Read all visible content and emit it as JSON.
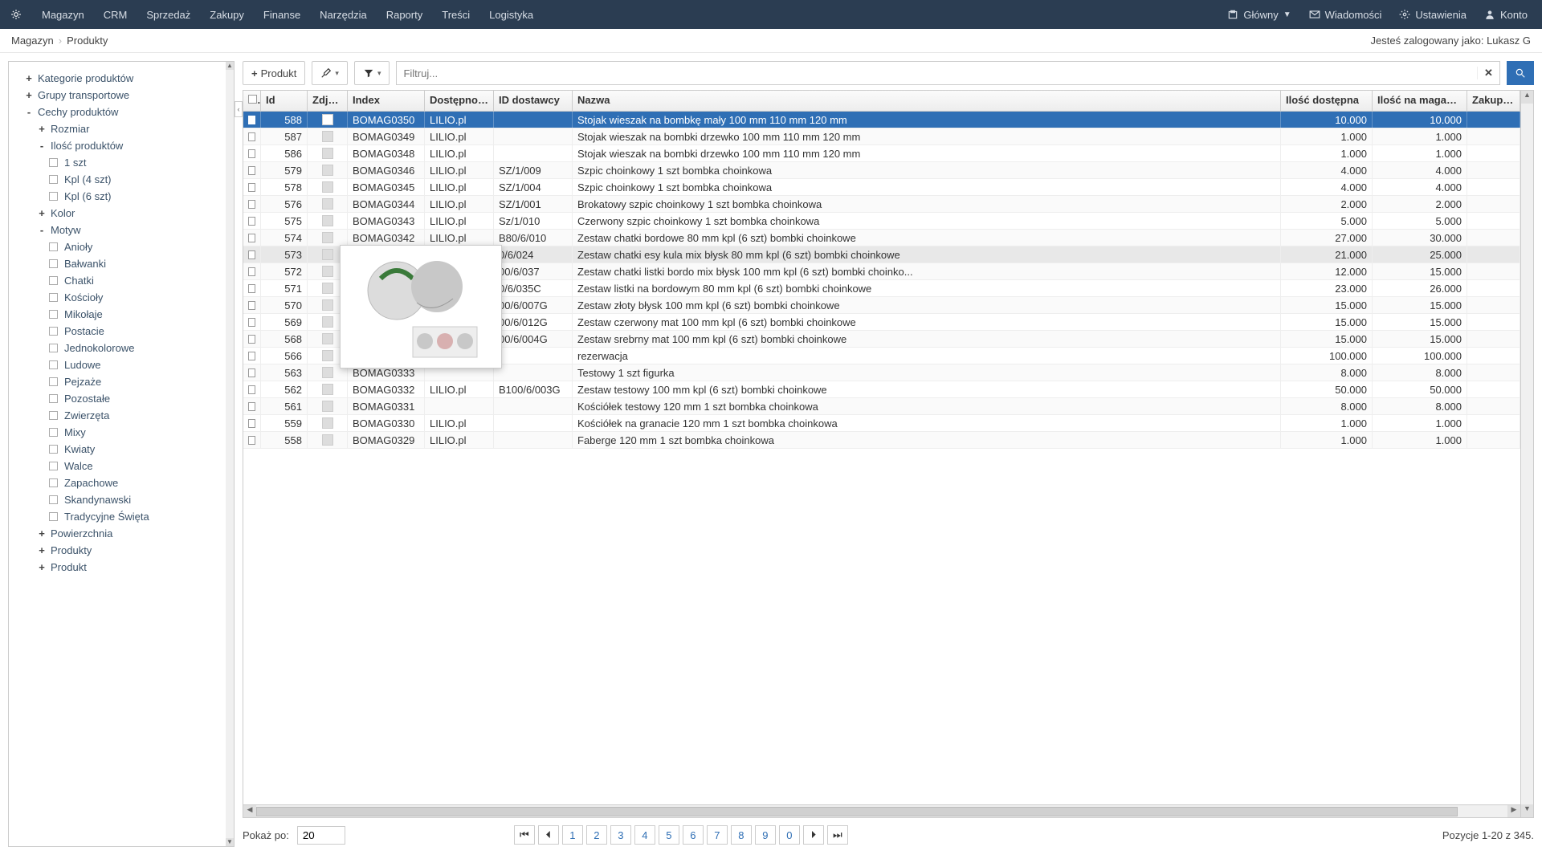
{
  "top_menu": [
    "Magazyn",
    "CRM",
    "Sprzedaż",
    "Zakupy",
    "Finanse",
    "Narzędzia",
    "Raporty",
    "Treści",
    "Logistyka"
  ],
  "top_right": {
    "main": "Główny",
    "messages": "Wiadomości",
    "settings": "Ustawienia",
    "account": "Konto"
  },
  "breadcrumb": {
    "root": "Magazyn",
    "leaf": "Produkty"
  },
  "logged_in_prefix": "Jesteś zalogowany jako: ",
  "logged_in_user": "Lukasz G",
  "toolbar": {
    "add_product": "Produkt",
    "filter_placeholder": "Filtruj..."
  },
  "sidebar": {
    "nodes": [
      {
        "exp": "+",
        "label": "Kategorie produktów"
      },
      {
        "exp": "+",
        "label": "Grupy transportowe"
      },
      {
        "exp": "-",
        "label": "Cechy produktów",
        "children": [
          {
            "exp": "+",
            "label": "Rozmiar"
          },
          {
            "exp": "-",
            "label": "Ilość produktów",
            "children": [
              {
                "chk": true,
                "label": "1 szt"
              },
              {
                "chk": true,
                "label": "Kpl (4 szt)"
              },
              {
                "chk": true,
                "label": "Kpl (6 szt)"
              }
            ]
          },
          {
            "exp": "+",
            "label": "Kolor"
          },
          {
            "exp": "-",
            "label": "Motyw",
            "children": [
              {
                "chk": true,
                "label": "Anioły"
              },
              {
                "chk": true,
                "label": "Bałwanki"
              },
              {
                "chk": true,
                "label": "Chatki"
              },
              {
                "chk": true,
                "label": "Kościoły"
              },
              {
                "chk": true,
                "label": "Mikołaje"
              },
              {
                "chk": true,
                "label": "Postacie"
              },
              {
                "chk": true,
                "label": "Jednokolorowe"
              },
              {
                "chk": true,
                "label": "Ludowe"
              },
              {
                "chk": true,
                "label": "Pejzaże"
              },
              {
                "chk": true,
                "label": "Pozostałe"
              },
              {
                "chk": true,
                "label": "Zwierzęta"
              },
              {
                "chk": true,
                "label": "Mixy"
              },
              {
                "chk": true,
                "label": "Kwiaty"
              },
              {
                "chk": true,
                "label": "Walce"
              },
              {
                "chk": true,
                "label": "Zapachowe"
              },
              {
                "chk": true,
                "label": "Skandynawski"
              },
              {
                "chk": true,
                "label": "Tradycyjne Święta"
              }
            ]
          },
          {
            "exp": "+",
            "label": "Powierzchnia"
          },
          {
            "exp": "+",
            "label": "Produkty"
          },
          {
            "exp": "+",
            "label": "Produkt"
          }
        ]
      }
    ]
  },
  "columns": [
    "",
    "Id",
    "Zdjęcie",
    "Index",
    "Dostępność",
    "ID dostawcy",
    "Nazwa",
    "Ilość dostępna",
    "Ilość na magazyn...",
    "Zakup bru"
  ],
  "rows": [
    {
      "sel": true,
      "id": 588,
      "idx": "BOMAG0350",
      "av": "LILIO.pl",
      "sup": "",
      "name": "Stojak wieszak na bombkę mały 100 mm 110 mm 120 mm",
      "q1": "10.000",
      "q2": "10.000"
    },
    {
      "id": 587,
      "idx": "BOMAG0349",
      "av": "LILIO.pl",
      "sup": "",
      "name": "Stojak wieszak na bombki drzewko 100 mm 110 mm 120 mm",
      "q1": "1.000",
      "q2": "1.000"
    },
    {
      "id": 586,
      "idx": "BOMAG0348",
      "av": "LILIO.pl",
      "sup": "",
      "name": "Stojak wieszak na bombki drzewko 100 mm 110 mm 120 mm",
      "q1": "1.000",
      "q2": "1.000"
    },
    {
      "id": 579,
      "idx": "BOMAG0346",
      "av": "LILIO.pl",
      "sup": "SZ/1/009",
      "name": "Szpic choinkowy 1 szt bombka choinkowa",
      "q1": "4.000",
      "q2": "4.000"
    },
    {
      "id": 578,
      "idx": "BOMAG0345",
      "av": "LILIO.pl",
      "sup": "SZ/1/004",
      "name": "Szpic choinkowy 1 szt bombka choinkowa",
      "q1": "4.000",
      "q2": "4.000"
    },
    {
      "id": 576,
      "idx": "BOMAG0344",
      "av": "LILIO.pl",
      "sup": "SZ/1/001",
      "name": "Brokatowy szpic choinkowy 1 szt bombka choinkowa",
      "q1": "2.000",
      "q2": "2.000"
    },
    {
      "id": 575,
      "idx": "BOMAG0343",
      "av": "LILIO.pl",
      "sup": "Sz/1/010",
      "name": "Czerwony szpic choinkowy 1 szt bombka choinkowa",
      "q1": "5.000",
      "q2": "5.000"
    },
    {
      "id": 574,
      "idx": "BOMAG0342",
      "av": "LILIO.pl",
      "sup": "B80/6/010",
      "name": "Zestaw chatki bordowe 80 mm kpl (6 szt) bombki choinkowe",
      "q1": "27.000",
      "q2": "30.000"
    },
    {
      "hov": true,
      "id": 573,
      "idx": "",
      "av": "",
      "sup": "0/6/024",
      "name": "Zestaw chatki esy kula mix błysk 80 mm kpl (6 szt) bombki choinkowe",
      "q1": "21.000",
      "q2": "25.000"
    },
    {
      "id": 572,
      "idx": "",
      "av": "",
      "sup": "00/6/037",
      "name": "Zestaw chatki listki bordo mix błysk 100 mm kpl (6 szt) bombki choinko...",
      "q1": "12.000",
      "q2": "15.000"
    },
    {
      "id": 571,
      "idx": "",
      "av": "",
      "sup": "0/6/035C",
      "name": "Zestaw listki na bordowym 80 mm kpl (6 szt) bombki choinkowe",
      "q1": "23.000",
      "q2": "26.000"
    },
    {
      "id": 570,
      "idx": "",
      "av": "",
      "sup": "00/6/007G",
      "name": "Zestaw złoty błysk 100 mm kpl (6 szt) bombki choinkowe",
      "q1": "15.000",
      "q2": "15.000"
    },
    {
      "id": 569,
      "idx": "",
      "av": "",
      "sup": "00/6/012G",
      "name": "Zestaw czerwony mat 100 mm kpl (6 szt) bombki choinkowe",
      "q1": "15.000",
      "q2": "15.000"
    },
    {
      "id": 568,
      "idx": "",
      "av": "",
      "sup": "00/6/004G",
      "name": "Zestaw srebrny mat 100 mm kpl (6 szt) bombki choinkowe",
      "q1": "15.000",
      "q2": "15.000"
    },
    {
      "id": 566,
      "idx": "",
      "av": "",
      "sup": "",
      "name": "rezerwacja",
      "q1": "100.000",
      "q2": "100.000"
    },
    {
      "id": 563,
      "idx": "BOMAG0333",
      "av": "",
      "sup": "",
      "name": "Testowy 1 szt figurka",
      "q1": "8.000",
      "q2": "8.000"
    },
    {
      "id": 562,
      "idx": "BOMAG0332",
      "av": "LILIO.pl",
      "sup": "B100/6/003G",
      "name": "Zestaw testowy 100 mm kpl (6 szt) bombki choinkowe",
      "q1": "50.000",
      "q2": "50.000"
    },
    {
      "id": 561,
      "idx": "BOMAG0331",
      "av": "",
      "sup": "",
      "name": "Kościółek testowy 120 mm 1 szt bombka choinkowa",
      "q1": "8.000",
      "q2": "8.000"
    },
    {
      "id": 559,
      "idx": "BOMAG0330",
      "av": "LILIO.pl",
      "sup": "",
      "name": "Kościółek na granacie 120 mm 1 szt bombka choinkowa",
      "q1": "1.000",
      "q2": "1.000"
    },
    {
      "id": 558,
      "idx": "BOMAG0329",
      "av": "LILIO.pl",
      "sup": "",
      "name": "Faberge 120 mm 1 szt bombka choinkowa",
      "q1": "1.000",
      "q2": "1.000"
    }
  ],
  "pager": {
    "show_label": "Pokaż po:",
    "show_value": "20",
    "pages": [
      "1",
      "2",
      "3",
      "4",
      "5",
      "6",
      "7",
      "8",
      "9",
      "0"
    ],
    "info": "Pozycje 1-20 z 345."
  }
}
